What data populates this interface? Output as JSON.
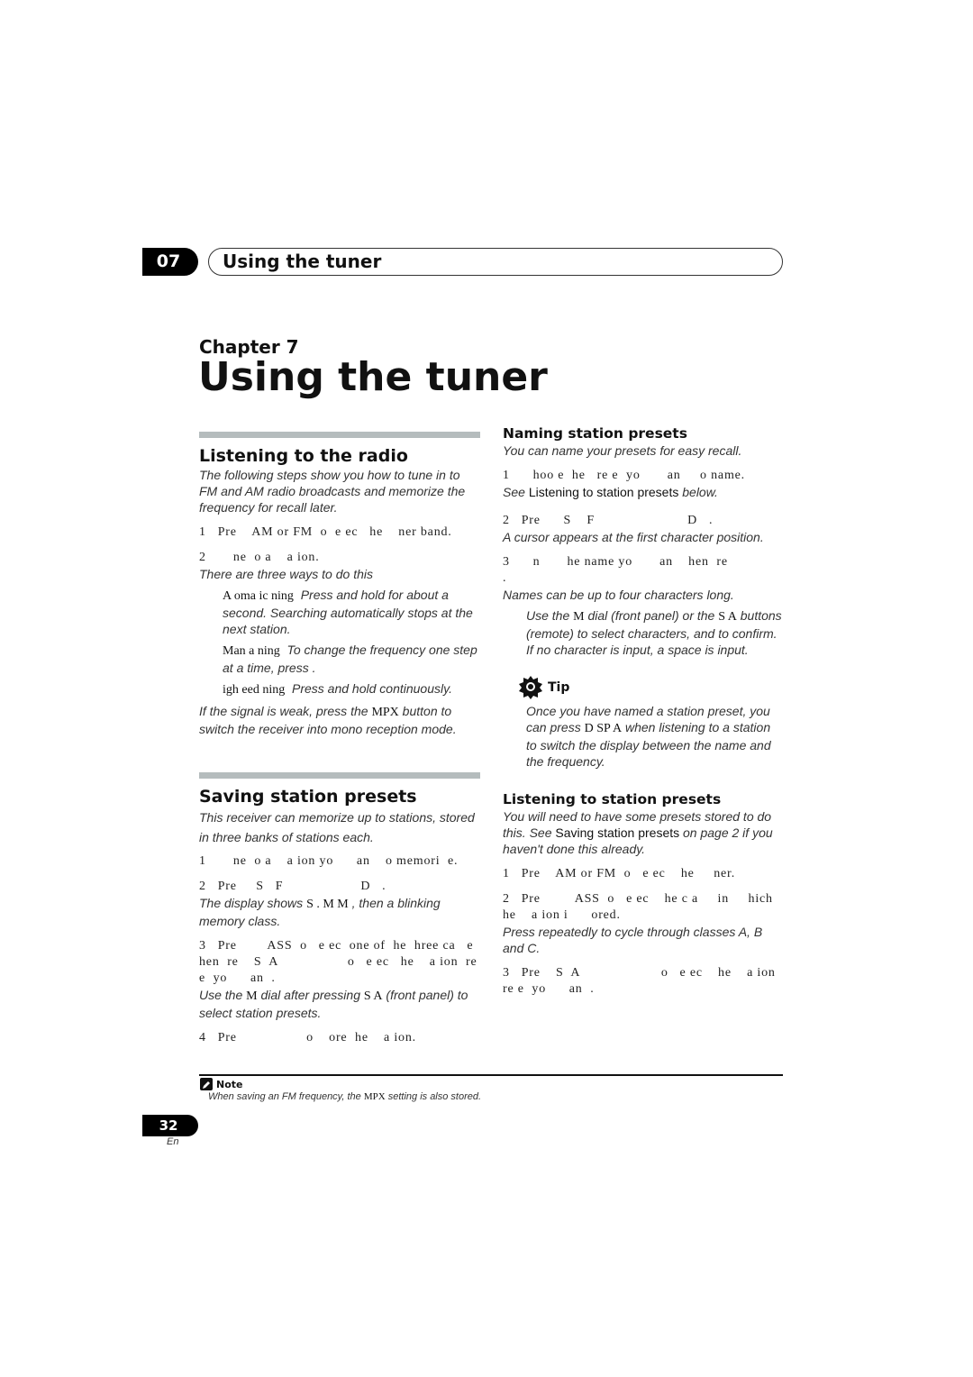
{
  "header": {
    "chapter_number": "07",
    "running_title": "Using the tuner"
  },
  "chapter_label": "Chapter 7",
  "page_title": "Using the tuner",
  "left": {
    "listening": {
      "title": "Listening to the radio",
      "intro": "The following steps show you how to tune in to FM and AM radio broadcasts and memorize the frequency for recall later.",
      "step1": "1   Pre    AM or FM  o  e ec   he    ner band.",
      "step2": "2       ne  o a    a ion.",
      "step2_note": "There are three ways to do this",
      "bullet1_label": "A   oma ic    ning",
      "bullet1_text": "Press and hold                  for about a second. Searching automatically stops at the next station.",
      "bullet2_label": "Man  a    ning",
      "bullet2_text": "To change the frequency one step at a time, press              .",
      "bullet3_label": "igh    eed    ning",
      "bullet3_text": "Press and hold                  continuously.",
      "mpx_note_pre": "If the signal is weak, press the ",
      "mpx_note_key": "MPX",
      "mpx_note_post": " button to switch the receiver into mono reception mode."
    },
    "saving": {
      "title": "Saving station presets",
      "intro": "This receiver can memorize up to     stations, stored in three banks of     stations each.",
      "step1": "1       ne  o a    a ion yo      an    o memori  e.",
      "step2": "2   Pre     S   F                    D   .",
      "step2_note_pre": "The display shows ",
      "step2_note_key": "S   . M   M",
      "step2_note_post": "       , then a blinking memory class.",
      "step3": "3   Pre        ASS  o   e ec  one of  he  hree ca   e   hen  re    S  A                  o   e ec   he    a ion  re e  yo      an  .",
      "step3_note_pre": "Use the ",
      "step3_note_key1": "M",
      "step3_note_mid": "                 dial after pressing ",
      "step3_note_key2": "S  A",
      "step3_note_post": "         (front panel) to select station presets.",
      "step4": "4   Pre                  o    ore  he    a ion."
    }
  },
  "right": {
    "naming": {
      "title": "Naming station presets",
      "intro": "You can name your presets for easy recall.",
      "step1": "1      hoo e  he   re e  yo       an     o name.",
      "step1_note_pre": "See ",
      "step1_note_ref": "Listening to station presets",
      "step1_note_post": " below.",
      "step2": "2   Pre      S    F                        D   .",
      "step2_note": "A cursor appears at the first character position.",
      "step3": "3      n       he name yo       an    hen  re                .",
      "step3_note": "Names can be up to four characters long.",
      "bullet_pre": "Use the ",
      "bullet_key1": "M",
      "bullet_mid1": "                dial (front panel) or the ",
      "bullet_key2": "S  A",
      "bullet_mid2": "              buttons (remote) to select characters, and              to confirm. If no character is input, a space is input."
    },
    "tip": {
      "label": "Tip",
      "text_pre": "Once you have named a station preset, you can press ",
      "text_key": "D SP  A",
      "text_post": "    when listening to a station to switch the display between the name and the frequency."
    },
    "listening_presets": {
      "title": "Listening to station presets",
      "intro_pre": "You will need to have some presets stored to do this. See ",
      "intro_ref": "Saving station presets",
      "intro_post": " on page   2 if you haven't done this already.",
      "step1": "1   Pre    AM or FM  o   e ec    he     ner.",
      "step2": "2   Pre         ASS  o   e ec    he c a     in     hich  he    a ion i      ored.",
      "step2_note": "Press repeatedly to cycle through classes A, B and C.",
      "step3": "3   Pre    S  A                     o   e ec    he    a ion  re e  yo      an  ."
    }
  },
  "footer_note": {
    "label": "Note",
    "text_pre": "When saving an FM frequency, the ",
    "text_key": "MPX",
    "text_post": " setting is also stored."
  },
  "page_number": "32",
  "language": "En"
}
